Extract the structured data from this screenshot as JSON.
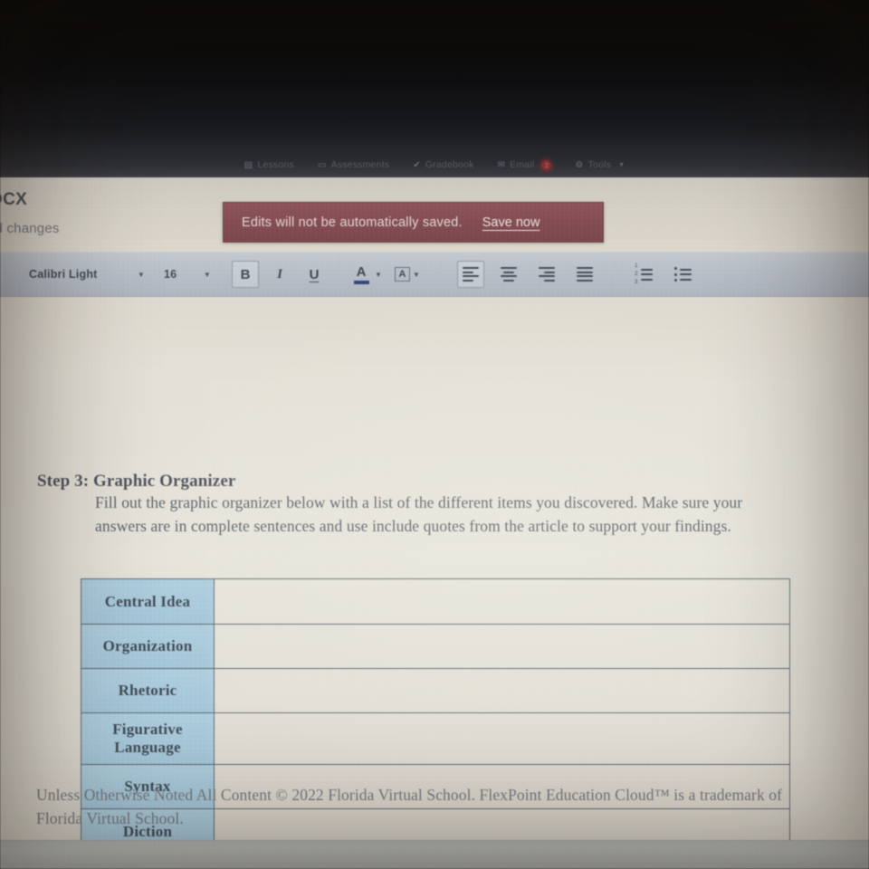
{
  "nav": {
    "items": [
      {
        "label": "Lessons",
        "icon": "book-icon",
        "glyph": "▤",
        "badge": null
      },
      {
        "label": "Assessments",
        "icon": "clipboard-icon",
        "glyph": "▭",
        "badge": null
      },
      {
        "label": "Gradebook",
        "icon": "check-icon",
        "glyph": "✔",
        "badge": null
      },
      {
        "label": "Email",
        "icon": "envelope-icon",
        "glyph": "✉",
        "badge": "2"
      },
      {
        "label": "Tools",
        "icon": "gear-icon",
        "glyph": "⚙",
        "badge": null,
        "caret": "▼"
      }
    ]
  },
  "document": {
    "file_title": "OCX",
    "file_subtitle": "ed changes"
  },
  "banner": {
    "message": "Edits will not be automatically saved.",
    "action_label": "Save now",
    "background_color": "#86474e",
    "text_color": "#e6d2d4"
  },
  "toolbar": {
    "font_family_value": "Calibri Light",
    "font_size_value": "16",
    "caret_glyph": "▼",
    "bold_label": "B",
    "italic_label": "I",
    "underline_label": "U",
    "text_color_label": "A",
    "text_color_swatch": "#2f3f7a",
    "highlight_label": "A",
    "align_left_name": "align-left",
    "align_center_name": "align-center",
    "align_right_name": "align-right",
    "align_justify_name": "align-justify",
    "numbered_list_marks": [
      "1",
      "2",
      "3"
    ],
    "bullet_list_name": "bulleted-list"
  },
  "content": {
    "heading": "Step 3: Graphic Organizer",
    "paragraph": "Fill out the graphic organizer below with a list of the different items you discovered. Make sure your answers are in complete sentences and use include quotes from the article to support your findings.",
    "table": {
      "label_bg_color": "#a3cbe0",
      "border_color": "#5c626e",
      "rows": [
        {
          "label": "Central Idea",
          "value": ""
        },
        {
          "label": "Organization",
          "value": ""
        },
        {
          "label": "Rhetoric",
          "value": ""
        },
        {
          "label": "Figurative Language",
          "value": ""
        },
        {
          "label": "Syntax",
          "value": ""
        },
        {
          "label": "Diction",
          "value": ""
        }
      ]
    },
    "footer": "Unless Otherwise Noted All Content © 2022 Florida Virtual School. FlexPoint Education Cloud™ is a trademark of Florida Virtual School."
  }
}
